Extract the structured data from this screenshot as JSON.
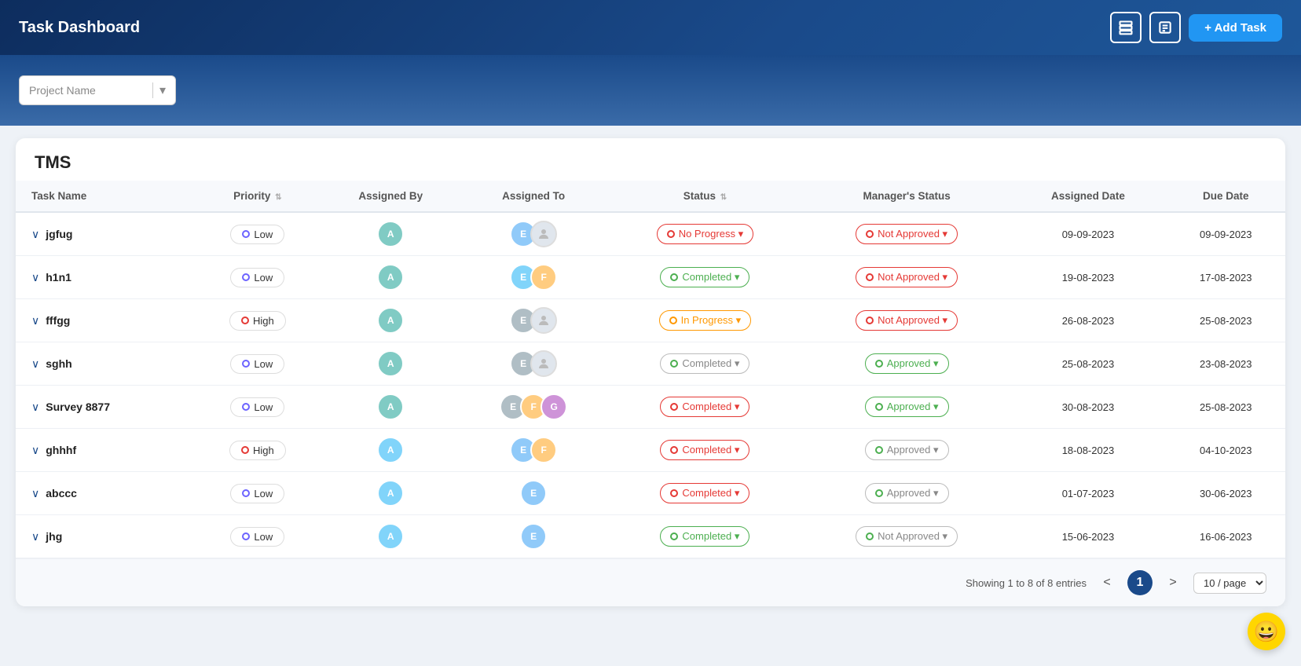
{
  "header": {
    "title": "Task Dashboard",
    "add_task_label": "+ Add Task",
    "icon1": "list-icon",
    "icon2": "document-icon"
  },
  "sub_header": {
    "project_select_placeholder": "Project Name"
  },
  "table": {
    "section_title": "TMS",
    "columns": [
      "Task Name",
      "Priority",
      "Assigned By",
      "Assigned To",
      "Status",
      "Manager's Status",
      "Assigned Date",
      "Due Date"
    ],
    "rows": [
      {
        "id": 1,
        "name": "jgfug",
        "priority": "Low",
        "priority_type": "low",
        "assigned_by_count": 1,
        "assigned_to_count": 2,
        "status": "No Progress",
        "status_type": "no-progress",
        "manager_status": "Not Approved",
        "manager_type": "not-approved",
        "assigned_date": "09-09-2023",
        "due_date": "09-09-2023"
      },
      {
        "id": 2,
        "name": "h1n1",
        "priority": "Low",
        "priority_type": "low",
        "assigned_by_count": 1,
        "assigned_to_count": 2,
        "status": "Completed",
        "status_type": "completed-green",
        "manager_status": "Not Approved",
        "manager_type": "not-approved",
        "assigned_date": "19-08-2023",
        "due_date": "17-08-2023"
      },
      {
        "id": 3,
        "name": "fffgg",
        "priority": "High",
        "priority_type": "high",
        "assigned_by_count": 1,
        "assigned_to_count": 2,
        "status": "In Progress",
        "status_type": "in-progress",
        "manager_status": "Not Approved",
        "manager_type": "not-approved",
        "assigned_date": "26-08-2023",
        "due_date": "25-08-2023"
      },
      {
        "id": 4,
        "name": "sghh",
        "priority": "Low",
        "priority_type": "low",
        "assigned_by_count": 1,
        "assigned_to_count": 2,
        "status": "Completed",
        "status_type": "completed-grey",
        "manager_status": "Approved",
        "manager_type": "approved",
        "assigned_date": "25-08-2023",
        "due_date": "23-08-2023"
      },
      {
        "id": 5,
        "name": "Survey 8877",
        "priority": "Low",
        "priority_type": "low",
        "assigned_by_count": 1,
        "assigned_to_count": 3,
        "status": "Completed",
        "status_type": "completed-red",
        "manager_status": "Approved",
        "manager_type": "approved",
        "assigned_date": "30-08-2023",
        "due_date": "25-08-2023"
      },
      {
        "id": 6,
        "name": "ghhhf",
        "priority": "High",
        "priority_type": "high",
        "assigned_by_count": 1,
        "assigned_to_count": 2,
        "status": "Completed",
        "status_type": "completed-red",
        "manager_status": "Approved",
        "manager_type": "approved-grey",
        "assigned_date": "18-08-2023",
        "due_date": "04-10-2023"
      },
      {
        "id": 7,
        "name": "abccc",
        "priority": "Low",
        "priority_type": "low",
        "assigned_by_count": 1,
        "assigned_to_count": 1,
        "status": "Completed",
        "status_type": "completed-red",
        "manager_status": "Approved",
        "manager_type": "approved-grey",
        "assigned_date": "01-07-2023",
        "due_date": "30-06-2023"
      },
      {
        "id": 8,
        "name": "jhg",
        "priority": "Low",
        "priority_type": "low",
        "assigned_by_count": 1,
        "assigned_to_count": 1,
        "status": "Completed",
        "status_type": "completed-green",
        "manager_status": "Not Approved",
        "manager_type": "not-approved-grey",
        "assigned_date": "15-06-2023",
        "due_date": "16-06-2023"
      }
    ]
  },
  "footer": {
    "info": "Showing 1 to 8 of 8 entries",
    "prev_label": "<",
    "next_label": ">",
    "current_page": "1",
    "per_page": "10 / page"
  },
  "emoji": "😀"
}
